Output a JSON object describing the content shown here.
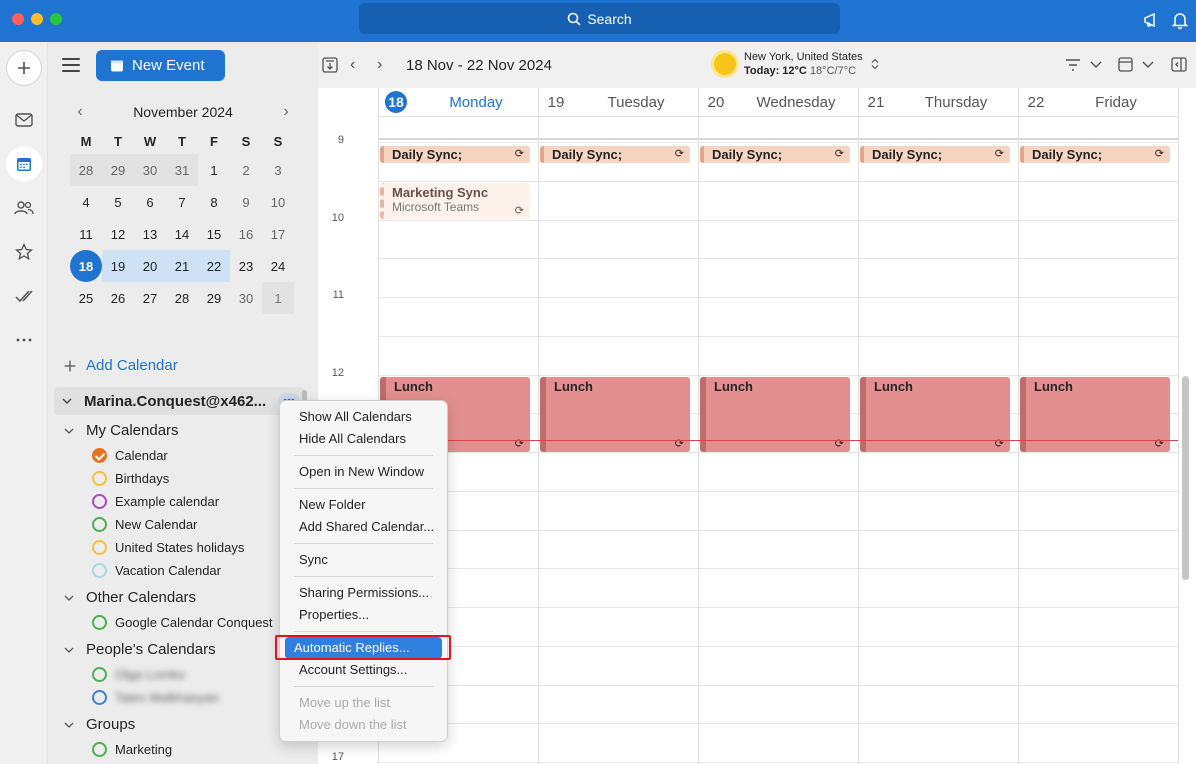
{
  "titlebar": {
    "search_label": "Search"
  },
  "sidebar": {
    "new_event_label": "New Event",
    "mini_calendar": {
      "month_label": "November 2024",
      "weekdays": [
        "M",
        "T",
        "W",
        "T",
        "F",
        "S",
        "S"
      ],
      "weeks": [
        [
          "28",
          "29",
          "30",
          "31",
          "1",
          "2",
          "3"
        ],
        [
          "4",
          "5",
          "6",
          "7",
          "8",
          "9",
          "10"
        ],
        [
          "11",
          "12",
          "13",
          "14",
          "15",
          "16",
          "17"
        ],
        [
          "18",
          "19",
          "20",
          "21",
          "22",
          "23",
          "24"
        ],
        [
          "25",
          "26",
          "27",
          "28",
          "29",
          "30",
          "1"
        ]
      ],
      "today": "18"
    },
    "add_calendar_label": "Add Calendar",
    "account_label": "Marina.Conquest@x462...",
    "more_label": "•••",
    "groups": [
      {
        "label": "My Calendars",
        "items": [
          {
            "label": "Calendar",
            "color": "#e8721c",
            "checked": true
          },
          {
            "label": "Birthdays",
            "color": "#f3c13a"
          },
          {
            "label": "Example calendar",
            "color": "#b146c2"
          },
          {
            "label": "New Calendar",
            "color": "#4caf50"
          },
          {
            "label": "United States holidays",
            "color": "#f3c13a"
          },
          {
            "label": "Vacation Calendar",
            "color": "#a6d8e6"
          }
        ]
      },
      {
        "label": "Other Calendars",
        "items": [
          {
            "label": "Google Calendar Conquest",
            "color": "#4caf50"
          }
        ]
      },
      {
        "label": "People's Calendars",
        "items": [
          {
            "label": "Olga Lomko",
            "color": "#4caf50"
          },
          {
            "label": "Tatev Malkhasyan",
            "color": "#3b82d6"
          }
        ]
      },
      {
        "label": "Groups",
        "items": [
          {
            "label": "Marketing",
            "color": "#4caf50"
          }
        ]
      }
    ]
  },
  "toolbar": {
    "date_range": "18 Nov - 22 Nov 2024",
    "weather_location": "New York, United States",
    "weather_today": "Today: 12°C",
    "weather_range": "18°C/7°C"
  },
  "week": {
    "days": [
      {
        "num": "18",
        "name": "Monday",
        "today": true
      },
      {
        "num": "19",
        "name": "Tuesday"
      },
      {
        "num": "20",
        "name": "Wednesday"
      },
      {
        "num": "21",
        "name": "Thursday"
      },
      {
        "num": "22",
        "name": "Friday"
      }
    ],
    "hours": [
      "9",
      "10",
      "11",
      "12",
      "17"
    ],
    "events": {
      "daily_sync": "Daily Sync;",
      "marketing_title": "Marketing Sync",
      "marketing_sub": "Microsoft Teams",
      "lunch": "Lunch",
      "repeat_glyph": "⟳"
    }
  },
  "context_menu": {
    "items": [
      [
        "Show All Calendars",
        "Hide All Calendars"
      ],
      [
        "Open in New Window"
      ],
      [
        "New Folder",
        "Add Shared Calendar..."
      ],
      [
        "Sync"
      ],
      [
        "Sharing Permissions...",
        "Properties..."
      ],
      [
        "Automatic Replies...",
        "Account Settings..."
      ],
      [
        "Move up the list",
        "Move down the list"
      ]
    ],
    "selected": "Automatic Replies...",
    "disabled": [
      "Move up the list",
      "Move down the list"
    ]
  }
}
